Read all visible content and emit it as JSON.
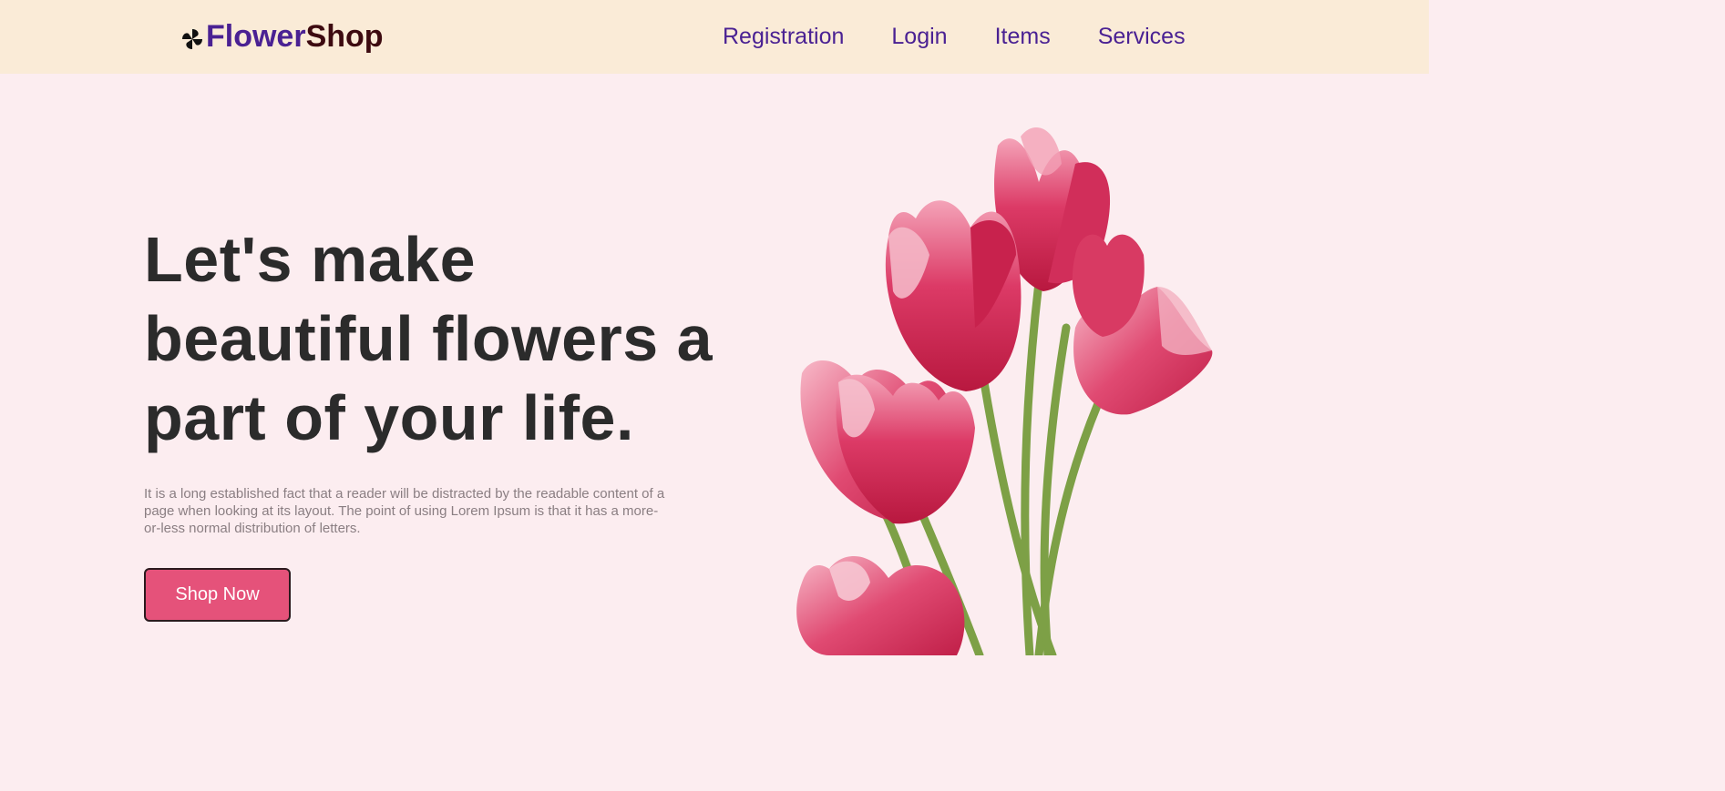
{
  "header": {
    "logo": {
      "icon": "pinwheel-icon",
      "word1": "Flower",
      "word2": "Shop"
    },
    "nav": [
      {
        "label": "Registration"
      },
      {
        "label": "Login"
      },
      {
        "label": "Items"
      },
      {
        "label": "Services"
      }
    ]
  },
  "hero": {
    "headline": "Let's make beautiful flowers a part of your life.",
    "description": "It is a long established fact that a reader will be distracted by the readable content of a page when looking at its layout. The point of using Lorem Ipsum is that it has a more-or-less normal distribution of letters.",
    "cta_label": "Shop Now",
    "image": "pink-tulips-bouquet"
  },
  "colors": {
    "header_bg": "#faebd7",
    "page_bg": "#fcedf0",
    "brand_purple": "#4a2193",
    "brand_maroon": "#3d0a10",
    "button": "#e5527a",
    "tulip_pink": "#d8325e",
    "stem_green": "#7da046"
  }
}
